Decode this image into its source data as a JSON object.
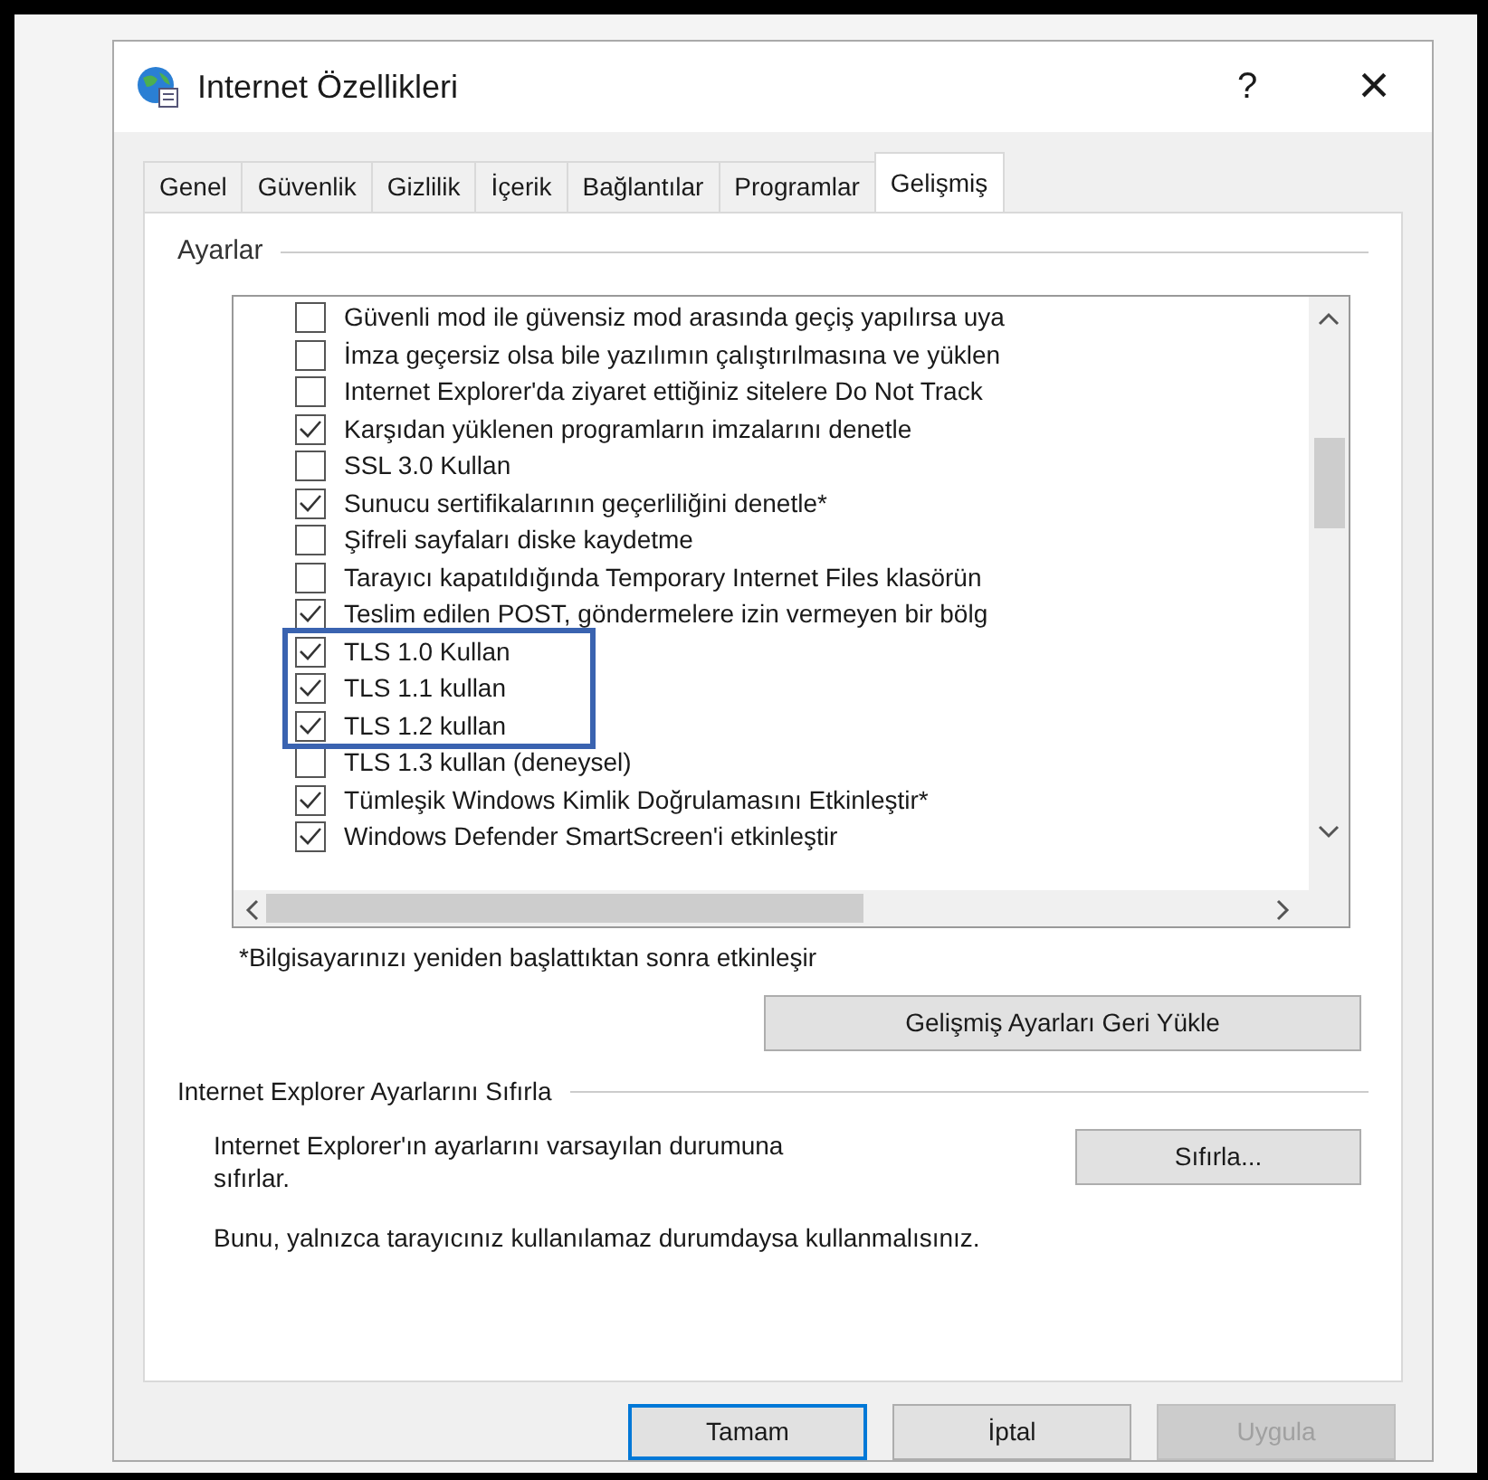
{
  "window": {
    "title": "Internet Özellikleri",
    "help": "?",
    "close": "×"
  },
  "tabs": [
    {
      "label": "Genel",
      "selected": false
    },
    {
      "label": "Güvenlik",
      "selected": false
    },
    {
      "label": "Gizlilik",
      "selected": false
    },
    {
      "label": "İçerik",
      "selected": false
    },
    {
      "label": "Bağlantılar",
      "selected": false
    },
    {
      "label": "Programlar",
      "selected": false
    },
    {
      "label": "Gelişmiş",
      "selected": true
    }
  ],
  "settings": {
    "title": "Ayarlar",
    "items": [
      {
        "label": "Güvenli mod ile güvensiz mod arasında geçiş yapılırsa uya",
        "checked": false,
        "highlighted": false
      },
      {
        "label": "İmza geçersiz olsa bile yazılımın çalıştırılmasına ve yüklen",
        "checked": false,
        "highlighted": false
      },
      {
        "label": "Internet Explorer'da ziyaret ettiğiniz sitelere Do Not Track",
        "checked": false,
        "highlighted": false
      },
      {
        "label": "Karşıdan yüklenen programların imzalarını denetle",
        "checked": true,
        "highlighted": false
      },
      {
        "label": "SSL 3.0 Kullan",
        "checked": false,
        "highlighted": false
      },
      {
        "label": "Sunucu sertifikalarının geçerliliğini denetle*",
        "checked": true,
        "highlighted": false
      },
      {
        "label": "Şifreli sayfaları diske kaydetme",
        "checked": false,
        "highlighted": false
      },
      {
        "label": "Tarayıcı kapatıldığında Temporary Internet  Files klasörün",
        "checked": false,
        "highlighted": false
      },
      {
        "label": "Teslim edilen POST, göndermelere izin vermeyen bir bölg",
        "checked": true,
        "highlighted": false
      },
      {
        "label": "TLS 1.0 Kullan",
        "checked": true,
        "highlighted": true
      },
      {
        "label": "TLS 1.1 kullan",
        "checked": true,
        "highlighted": true
      },
      {
        "label": "TLS 1.2 kullan",
        "checked": true,
        "highlighted": true
      },
      {
        "label": "TLS 1.3 kullan (deneysel)",
        "checked": false,
        "highlighted": false
      },
      {
        "label": "Tümleşik Windows Kimlik Doğrulamasını Etkinleştir*",
        "checked": true,
        "highlighted": false
      },
      {
        "label": "Windows Defender SmartScreen'i etkinleştir",
        "checked": true,
        "highlighted": false
      }
    ],
    "note": "*Bilgisayarınızı yeniden başlattıktan sonra etkinleşir",
    "restore_button": "Gelişmiş Ayarları Geri Yükle"
  },
  "reset": {
    "title": "Internet Explorer Ayarlarını Sıfırla",
    "description": "Internet Explorer'ın ayarlarını varsayılan durumuna sıfırlar.",
    "button": "Sıfırla...",
    "warning": "Bunu, yalnızca tarayıcınız kullanılamaz durumdaysa kullanmalısınız."
  },
  "buttons": [
    {
      "label": "Tamam",
      "default": true,
      "disabled": false
    },
    {
      "label": "İptal",
      "default": false,
      "disabled": false
    },
    {
      "label": "Uygula",
      "default": false,
      "disabled": true
    }
  ]
}
